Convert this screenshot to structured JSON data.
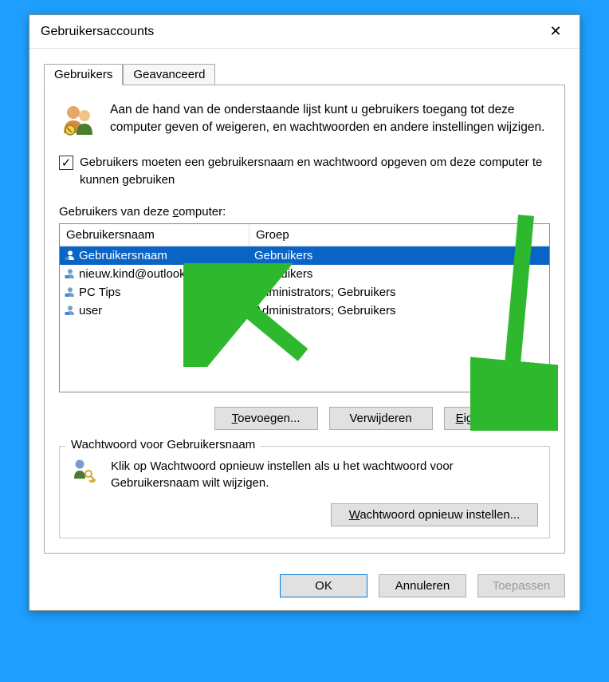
{
  "dialog": {
    "title": "Gebruikersaccounts"
  },
  "tabs": {
    "users": "Gebruikers",
    "advanced": "Geavanceerd"
  },
  "intro": "Aan de hand van de onderstaande lijst kunt u gebruikers toegang tot deze computer geven of weigeren, en wachtwoorden en andere instellingen wijzigen.",
  "checkbox": {
    "checked": true,
    "label": "Gebruikers moeten een gebruikersnaam en wachtwoord opgeven om deze computer te kunnen gebruiken"
  },
  "list_label_pre": "Gebruikers van deze ",
  "list_label_ul": "c",
  "list_label_post": "omputer:",
  "columns": {
    "username": "Gebruikersnaam",
    "group": "Groep"
  },
  "rows": [
    {
      "username": "Gebruikersnaam",
      "group": "Gebruikers",
      "selected": true
    },
    {
      "username": "nieuw.kind@outlook.com",
      "group": "Gebruikers",
      "selected": false
    },
    {
      "username": "PC Tips",
      "group": "Administrators; Gebruikers",
      "selected": false
    },
    {
      "username": "user",
      "group": "Administrators; Gebruikers",
      "selected": false
    }
  ],
  "buttons": {
    "add": "Toevoegen...",
    "remove": "Verwijderen",
    "properties": "Eigenschappen"
  },
  "password_box": {
    "legend": "Wachtwoord voor Gebruikersnaam",
    "text": "Klik op Wachtwoord opnieuw instellen als u het wachtwoord voor Gebruikersnaam wilt wijzigen.",
    "reset_btn": "Wachtwoord opnieuw instellen..."
  },
  "dialog_buttons": {
    "ok": "OK",
    "cancel": "Annuleren",
    "apply": "Toepassen"
  }
}
